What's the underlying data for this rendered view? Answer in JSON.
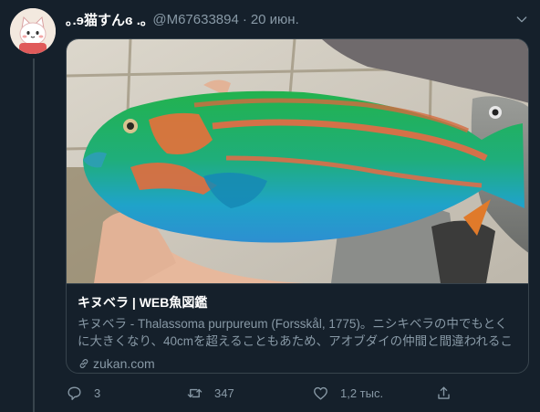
{
  "tweet": {
    "display_name": "｡.ɘ猫すんɞ .｡",
    "handle": "@M67633894",
    "separator": "·",
    "date": "20 июн."
  },
  "card": {
    "title": "キヌベラ | WEB魚図鑑",
    "description": "キヌベラ - Thalassoma purpureum (Forsskål, 1775)。ニシキベラの中でもとくに大きくなり、40cmを超えることもあため、アオブダイの仲間と間違われることもあるが、...",
    "domain": "zukan.com"
  },
  "actions": {
    "reply_count": "3",
    "retweet_count": "347",
    "like_count": "1,2 тыс."
  },
  "icons": {
    "reply": "reply-icon",
    "retweet": "retweet-icon",
    "like": "heart-icon",
    "share": "share-icon",
    "link": "link-icon",
    "menu": "chevron-down-icon"
  },
  "colors": {
    "background": "#15202b",
    "border": "#38444d",
    "secondary_text": "#8899a6",
    "primary_text": "#ffffff"
  }
}
